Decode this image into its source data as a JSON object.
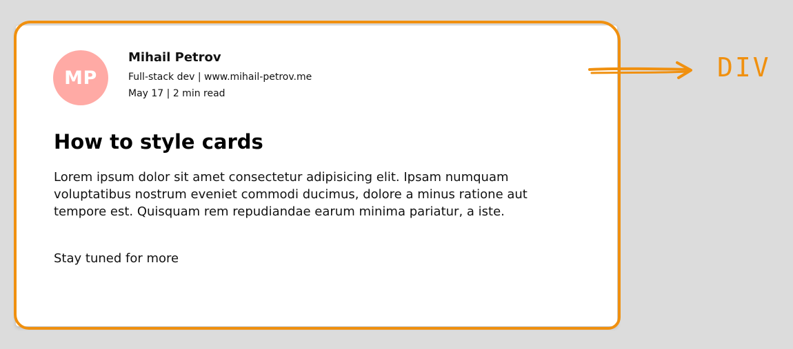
{
  "card": {
    "avatar_initials": "MP",
    "author_name": "Mihail Petrov",
    "author_role": "Full-stack dev | www.mihail-petrov.me",
    "post_meta": "May 17 | 2 min read",
    "title": "How to style cards",
    "body": "Lorem ipsum dolor sit amet consectetur adipisicing elit. Ipsam numquam voluptatibus nostrum eveniet commodi ducimus, dolore a minus ratione aut tempore est. Quisquam rem repudiandae earum minima pariatur, a iste.",
    "footer": "Stay tuned for more"
  },
  "annotation": {
    "label": "DIV",
    "icon": "arrow-right-icon"
  },
  "colors": {
    "background": "#dcdcdc",
    "card": "#ffffff",
    "avatar": "#ffaaa5",
    "highlight": "#f0900f"
  }
}
